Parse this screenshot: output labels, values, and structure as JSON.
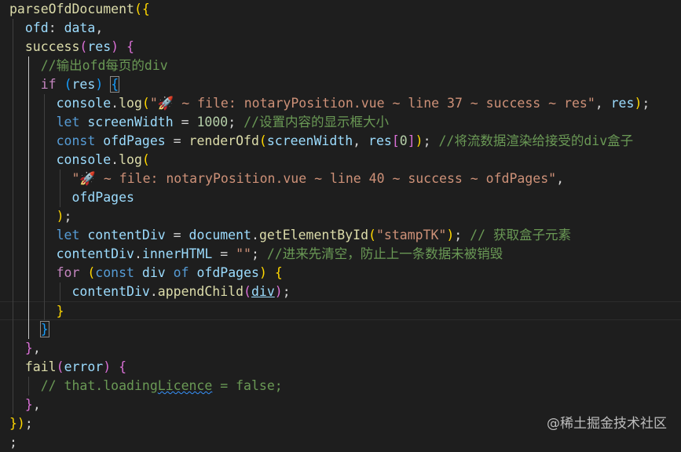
{
  "editor": {
    "lines": [
      [
        [
          "tok-fn",
          "parseOfdDocument"
        ],
        [
          "b1",
          "({"
        ]
      ],
      [
        [
          "tok-pun",
          "  "
        ],
        [
          "tok-var",
          "ofd"
        ],
        [
          "tok-pun",
          ": "
        ],
        [
          "tok-var",
          "data"
        ],
        [
          "tok-pun",
          ","
        ]
      ],
      [
        [
          "tok-pun",
          "  "
        ],
        [
          "tok-fn",
          "success"
        ],
        [
          "b2",
          "("
        ],
        [
          "tok-var",
          "res"
        ],
        [
          "b2",
          ")"
        ],
        [
          "tok-pun",
          " "
        ],
        [
          "b2",
          "{"
        ]
      ],
      [
        [
          "tok-pun",
          "    "
        ],
        [
          "tok-cm",
          "//输出ofd每页的div"
        ]
      ],
      [
        [
          "tok-pun",
          "    "
        ],
        [
          "tok-ctl",
          "if"
        ],
        [
          "tok-pun",
          " "
        ],
        [
          "b3",
          "("
        ],
        [
          "tok-var",
          "res"
        ],
        [
          "b3",
          ")"
        ],
        [
          "tok-pun",
          " "
        ],
        [
          "b3 boxb",
          "{"
        ]
      ],
      [
        [
          "tok-pun",
          "      "
        ],
        [
          "tok-var",
          "console"
        ],
        [
          "tok-pun",
          "."
        ],
        [
          "tok-fn",
          "log"
        ],
        [
          "b1",
          "("
        ],
        [
          "tok-str",
          "\"🚀 ~ file: notaryPosition.vue ~ line 37 ~ success ~ res\""
        ],
        [
          "tok-pun",
          ", "
        ],
        [
          "tok-var",
          "res"
        ],
        [
          "b1",
          ")"
        ],
        [
          "tok-pun",
          ";"
        ]
      ],
      [
        [
          "tok-pun",
          "      "
        ],
        [
          "tok-kw",
          "let"
        ],
        [
          "tok-pun",
          " "
        ],
        [
          "tok-var",
          "screenWidth"
        ],
        [
          "tok-pun",
          " = "
        ],
        [
          "tok-num",
          "1000"
        ],
        [
          "tok-pun",
          "; "
        ],
        [
          "tok-cm",
          "//设置内容的显示框大小"
        ]
      ],
      [
        [
          "tok-pun",
          "      "
        ],
        [
          "tok-kw",
          "const"
        ],
        [
          "tok-pun",
          " "
        ],
        [
          "tok-var",
          "ofdPages"
        ],
        [
          "tok-pun",
          " = "
        ],
        [
          "tok-fn",
          "renderOfd"
        ],
        [
          "b1",
          "("
        ],
        [
          "tok-var",
          "screenWidth"
        ],
        [
          "tok-pun",
          ", "
        ],
        [
          "tok-var",
          "res"
        ],
        [
          "b2",
          "["
        ],
        [
          "tok-num",
          "0"
        ],
        [
          "b2",
          "]"
        ],
        [
          "b1",
          ")"
        ],
        [
          "tok-pun",
          "; "
        ],
        [
          "tok-cm",
          "//将流数据渲染给接受的div盒子"
        ]
      ],
      [
        [
          "tok-pun",
          "      "
        ],
        [
          "tok-var",
          "console"
        ],
        [
          "tok-pun",
          "."
        ],
        [
          "tok-fn",
          "log"
        ],
        [
          "b1",
          "("
        ]
      ],
      [
        [
          "tok-pun",
          "        "
        ],
        [
          "tok-str",
          "\"🚀 ~ file: notaryPosition.vue ~ line 40 ~ success ~ ofdPages\""
        ],
        [
          "tok-pun",
          ","
        ]
      ],
      [
        [
          "tok-pun",
          "        "
        ],
        [
          "tok-var",
          "ofdPages"
        ]
      ],
      [
        [
          "tok-pun",
          "      "
        ],
        [
          "b1",
          ")"
        ],
        [
          "tok-pun",
          ";"
        ]
      ],
      [
        [
          "tok-pun",
          "      "
        ],
        [
          "tok-kw",
          "let"
        ],
        [
          "tok-pun",
          " "
        ],
        [
          "tok-var",
          "contentDiv"
        ],
        [
          "tok-pun",
          " = "
        ],
        [
          "tok-var",
          "document"
        ],
        [
          "tok-pun",
          "."
        ],
        [
          "tok-fn",
          "getElementById"
        ],
        [
          "b1",
          "("
        ],
        [
          "tok-str",
          "\"stampTK\""
        ],
        [
          "b1",
          ")"
        ],
        [
          "tok-pun",
          "; "
        ],
        [
          "tok-cm",
          "// 获取盒子元素"
        ]
      ],
      [
        [
          "tok-pun",
          "      "
        ],
        [
          "tok-var",
          "contentDiv"
        ],
        [
          "tok-pun",
          "."
        ],
        [
          "tok-var",
          "innerHTML"
        ],
        [
          "tok-pun",
          " = "
        ],
        [
          "tok-str",
          "\"\""
        ],
        [
          "tok-pun",
          "; "
        ],
        [
          "tok-cm",
          "//进来先清空，防止上一条数据未被销毁"
        ]
      ],
      [
        [
          "tok-pun",
          "      "
        ],
        [
          "tok-ctl",
          "for"
        ],
        [
          "tok-pun",
          " "
        ],
        [
          "b1",
          "("
        ],
        [
          "tok-kw",
          "const"
        ],
        [
          "tok-pun",
          " "
        ],
        [
          "tok-var",
          "div"
        ],
        [
          "tok-pun",
          " "
        ],
        [
          "tok-kw",
          "of"
        ],
        [
          "tok-pun",
          " "
        ],
        [
          "tok-var",
          "ofdPages"
        ],
        [
          "b1",
          ")"
        ],
        [
          "tok-pun",
          " "
        ],
        [
          "b1",
          "{"
        ]
      ],
      [
        [
          "tok-pun",
          "        "
        ],
        [
          "tok-var",
          "contentDiv"
        ],
        [
          "tok-pun",
          "."
        ],
        [
          "tok-fn",
          "appendChild"
        ],
        [
          "b2",
          "("
        ],
        [
          "tok-var und",
          "div"
        ],
        [
          "b2",
          ")"
        ],
        [
          "tok-pun",
          ";"
        ]
      ],
      [
        [
          "tok-pun",
          "      "
        ],
        [
          "b1",
          "}"
        ]
      ],
      [
        [
          "tok-pun",
          "    "
        ],
        [
          "b3 boxb",
          "}"
        ]
      ],
      [
        [
          "tok-pun",
          "  "
        ],
        [
          "b2",
          "}"
        ],
        [
          "tok-pun",
          ","
        ]
      ],
      [
        [
          "tok-pun",
          "  "
        ],
        [
          "tok-fn",
          "fail"
        ],
        [
          "b2",
          "("
        ],
        [
          "tok-var",
          "error"
        ],
        [
          "b2",
          ")"
        ],
        [
          "tok-pun",
          " "
        ],
        [
          "b2",
          "{"
        ]
      ],
      [
        [
          "tok-pun",
          "    "
        ],
        [
          "tok-cm",
          "// that.loading"
        ],
        [
          "tok-cm squig",
          "Licence"
        ],
        [
          "tok-cm",
          " = false;"
        ]
      ],
      [
        [
          "tok-pun",
          "  "
        ],
        [
          "b2",
          "}"
        ],
        [
          "tok-pun",
          ","
        ]
      ],
      [
        [
          "b1",
          "})"
        ],
        [
          "tok-pun",
          ";"
        ]
      ],
      [
        [
          "tok-pun",
          ";"
        ]
      ]
    ],
    "active_line": 16
  },
  "watermark": "@稀土掘金技术社区"
}
